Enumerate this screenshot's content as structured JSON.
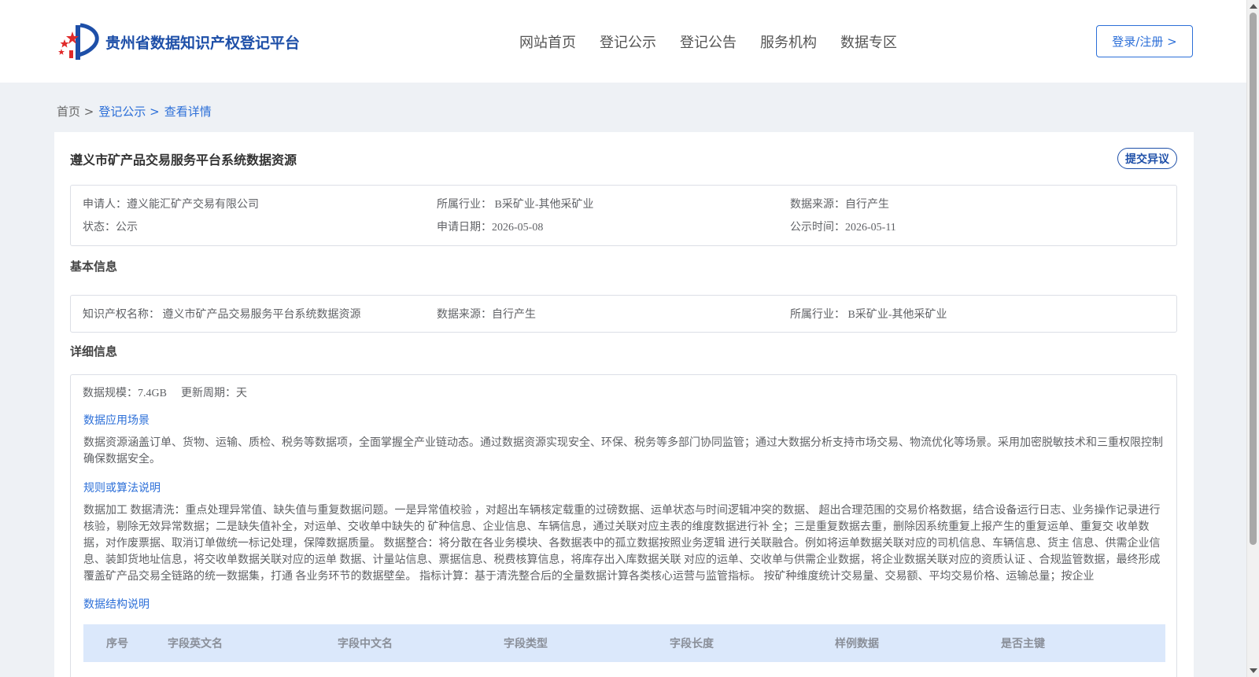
{
  "header": {
    "logo_text": "贵州省数据知识产权登记平台",
    "nav": [
      "网站首页",
      "登记公示",
      "登记公告",
      "服务机构",
      "数据专区"
    ],
    "login_label": "登录/注册 >"
  },
  "breadcrumb": {
    "home": "首页 >",
    "section": "登记公示 >",
    "current": "查看详情"
  },
  "detail": {
    "title": "遵义市矿产品交易服务平台系统数据资源",
    "objection_label": "提交异议",
    "summary": {
      "applicant": "申请人：遵义能汇矿产交易有限公司",
      "industry": "所属行业： B采矿业-其他采矿业",
      "source": "数据来源：自行产生",
      "status": "状态：公示",
      "apply_date": "申请日期：2026-05-08",
      "publish_date": "公示时间：2026-05-11"
    },
    "basic_title": "基本信息",
    "basic": {
      "ip_name": "知识产权名称： 遵义市矿产品交易服务平台系统数据资源",
      "source": "数据来源：自行产生",
      "industry": "所属行业： B采矿业-其他采矿业"
    },
    "detail_title": "详细信息",
    "scale": "数据规模：7.4GB",
    "cycle": "更新周期：天",
    "scenario_title": "数据应用场景",
    "scenario_text": "数据资源涵盖订单、货物、运输、质检、税务等数据项，全面掌握全产业链动态。通过数据资源实现安全、环保、税务等多部门协同监管；通过大数据分析支持市场交易、物流优化等场景。采用加密脱敏技术和三重权限控制确保数据安全。",
    "rules_title": "规则或算法说明",
    "rules_text": "数据加工 数据清洗：重点处理异常值、缺失值与重复数据问题。一是异常值校验 ，对超出车辆核定载重的过磅数据、运单状态与时间逻辑冲突的数据、 超出合理范围的交易价格数据，结合设备运行日志、业务操作记录进行核验，剔除无效异常数据；二是缺失值补全，对运单、交收单中缺失的 矿种信息、企业信息、车辆信息，通过关联对应主表的维度数据进行补 全；三是重复数据去重，删除因系统重复上报产生的重复运单、重复交 收单数据，对作废票据、取消订单做统一标记处理，保障数据质量。 数据整合：将分散在各业务模块、各数据表中的孤立数据按照业务逻辑 进行关联融合。例如将运单数据关联对应的司机信息、车辆信息、货主 信息、供需企业信息、装卸货地址信息，将交收单数据关联对应的运单 数据、计量站信息、票据信息、税费核算信息，将库存出入库数据关联 对应的运单、交收单与供需企业数据，将企业数据关联对应的资质认证 、合规监管数据，最终形成覆盖矿产品交易全链路的统一数据集，打通 各业务环节的数据壁垒。 指标计算：基于清洗整合后的全量数据计算各类核心运营与监管指标。 按矿种维度统计交易量、交易额、平均交易价格、运输总量；按企业",
    "structure_title": "数据结构说明",
    "table_headers": [
      "序号",
      "字段英文名",
      "字段中文名",
      "字段类型",
      "字段长度",
      "样例数据",
      "是否主键"
    ]
  },
  "colors": {
    "brand_blue": "#1e4fa8",
    "link_blue": "#2c6fd8",
    "table_head_bg": "#dbe8fb"
  }
}
